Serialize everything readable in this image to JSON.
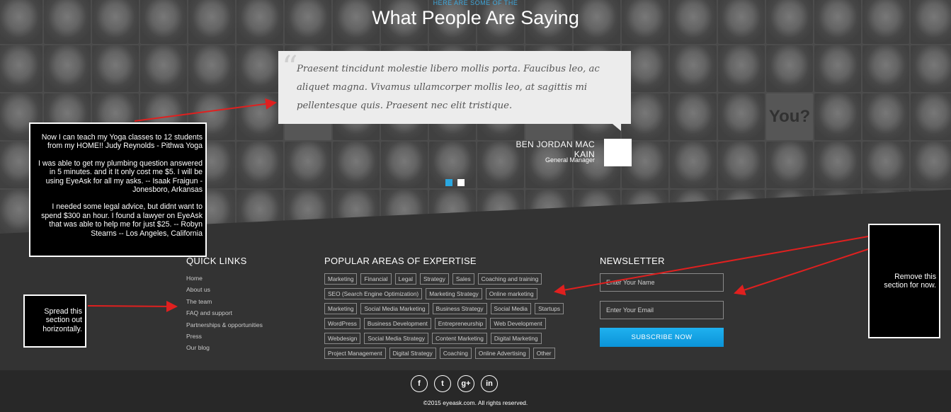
{
  "testimonials": {
    "kicker": "HERE ARE SOME OF THE",
    "title": "What People Are Saying",
    "quote": "Praesent tincidunt molestie libero mollis porta. Faucibus leo, ac aliquet magna. Vivamus ullamcorper mollis leo, at sagittis mi pellentesque quis. Praesent nec elit tristique.",
    "author_name": "BEN JORDAN MAC KAIN",
    "author_role": "General Manager",
    "slides": 2,
    "active_slide": 1,
    "tile_label": "You?"
  },
  "quick_links": {
    "title": "QUICK LINKS",
    "items": [
      "Home",
      "About us",
      "The team",
      "FAQ and support",
      "Partnerships & opportunities",
      "Press",
      "Our blog"
    ]
  },
  "expertise": {
    "title": "POPULAR AREAS OF EXPERTISE",
    "rows": [
      [
        "Marketing",
        "Financial",
        "Legal",
        "Strategy",
        "Sales",
        "Coaching and training"
      ],
      [
        "SEO (Search Engine Optimization)",
        "Marketing Strategy",
        "Online marketing"
      ],
      [
        "Marketing",
        "Social Media Marketing",
        "Business Strategy",
        "Social Media",
        "Startups"
      ],
      [
        "WordPress",
        "Business Development",
        "Entrepreneurship",
        "Web Development"
      ],
      [
        "Webdesign",
        "Social Media Strategy",
        "Content Marketing",
        "Digital Marketing"
      ],
      [
        "Project Management",
        "Digital Strategy",
        "Coaching",
        "Online Advertising",
        "Other"
      ]
    ]
  },
  "newsletter": {
    "title": "NEWSLETTER",
    "name_placeholder": "Enter Your Name",
    "email_placeholder": "Enter Your Email",
    "button": "SUBSCRIBE NOW"
  },
  "footer": {
    "social": [
      {
        "icon": "facebook-icon",
        "glyph": "f"
      },
      {
        "icon": "twitter-icon",
        "glyph": "t"
      },
      {
        "icon": "google-plus-icon",
        "glyph": "g+"
      },
      {
        "icon": "linkedin-icon",
        "glyph": "in"
      }
    ],
    "copyright": "©2015 eyeask.com. All rights reserved."
  },
  "annotations": {
    "testimonials_note": [
      "Now I can teach my Yoga classes to 12 students from my HOME!!          Judy Reynolds - Pithwa Yoga",
      "I was able to get my plumbing question answered in 5 minutes. and it It only cost me $5. I will be using EyeAsk for all my asks.      -- Isaak Fraigun  - Jonesboro, Arkansas",
      "I needed some legal advice, but didnt want to spend $300 an hour. I found a lawyer on EyeAsk that was able to help me for just $25.  -- Robyn Stearns    -- Los Angeles, California"
    ],
    "spread_note": "Spread this section out horizontally.",
    "remove_note": "Remove this section for now."
  },
  "colors": {
    "accent": "#2aa7e0",
    "footer_bg": "#333333",
    "bottom_bar": "#282828",
    "arrow": "#e0201f"
  }
}
